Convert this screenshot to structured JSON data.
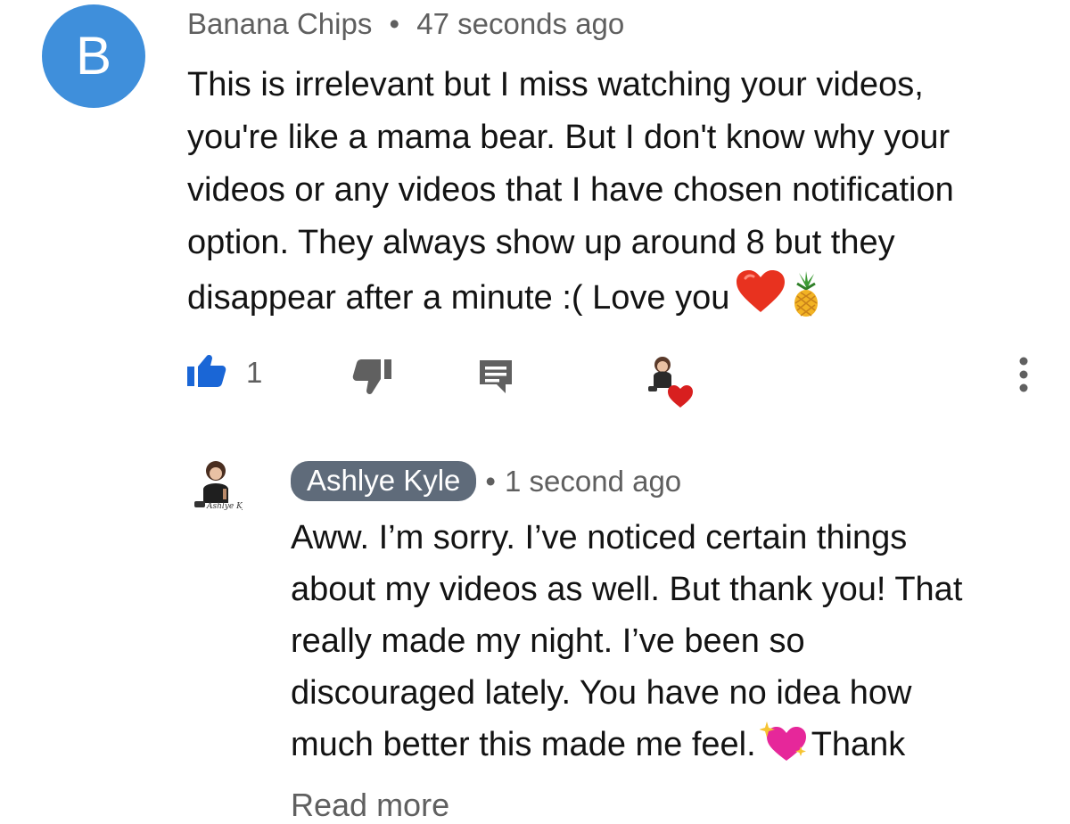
{
  "comment": {
    "avatar_letter": "B",
    "avatar_color": "#3f8fdb",
    "author": "Banana Chips",
    "separator": "•",
    "time": "47 seconds ago",
    "lines": [
      "This is irrelevant but I miss watching your videos,",
      "you're like a mama bear. But I don't know why your",
      "videos or any videos that I have chosen notification",
      "option. They always show up around 8 but they",
      "disappear after a minute :( Love you"
    ],
    "emojis": [
      "heart-emoji",
      "pineapple-emoji"
    ],
    "actions": {
      "like_count": "1",
      "like_color": "#1a66d6",
      "icons": [
        "thumbs-up-icon",
        "thumbs-down-icon",
        "reply-icon",
        "creator-heart-icon",
        "more-vert-icon"
      ]
    }
  },
  "reply": {
    "author": "Ashlye Kyle",
    "separator": "•",
    "time": "1 second ago",
    "lines": [
      "Aww. I’m sorry. I’ve noticed certain things",
      "about my videos as well. But thank you! That",
      "really made my night. I’ve been so",
      "discouraged lately. You have no idea how",
      "much better this made me feel."
    ],
    "line5_tail": "Thank",
    "emojis": [
      "sparkling-heart-emoji"
    ],
    "read_more": "Read more",
    "pill_color": "#5f6b7a"
  }
}
